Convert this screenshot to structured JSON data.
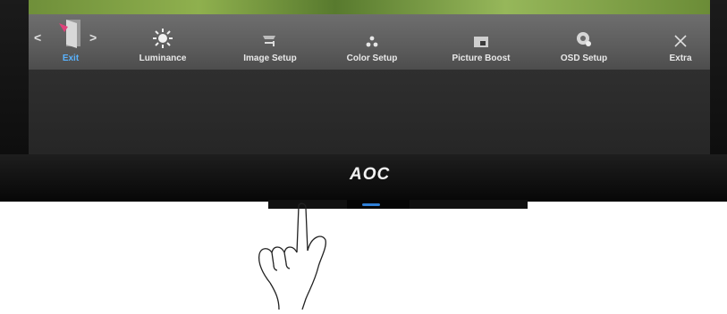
{
  "brand": {
    "logo": "AOC"
  },
  "osd_menu": {
    "nav_left": "<",
    "nav_right": ">",
    "items": [
      {
        "label": "Exit",
        "icon": "exit-door-icon",
        "active": true
      },
      {
        "label": "Luminance",
        "icon": "sun-icon"
      },
      {
        "label": "Image Setup",
        "icon": "image-setup-icon"
      },
      {
        "label": "Color Setup",
        "icon": "color-dots-icon"
      },
      {
        "label": "Picture Boost",
        "icon": "picture-boost-icon"
      },
      {
        "label": "OSD Setup",
        "icon": "osd-setup-icon"
      },
      {
        "label": "Extra",
        "icon": "tools-icon"
      }
    ]
  },
  "colors": {
    "active_label": "#5ab3ff",
    "power_led": "#2f7fd6"
  }
}
